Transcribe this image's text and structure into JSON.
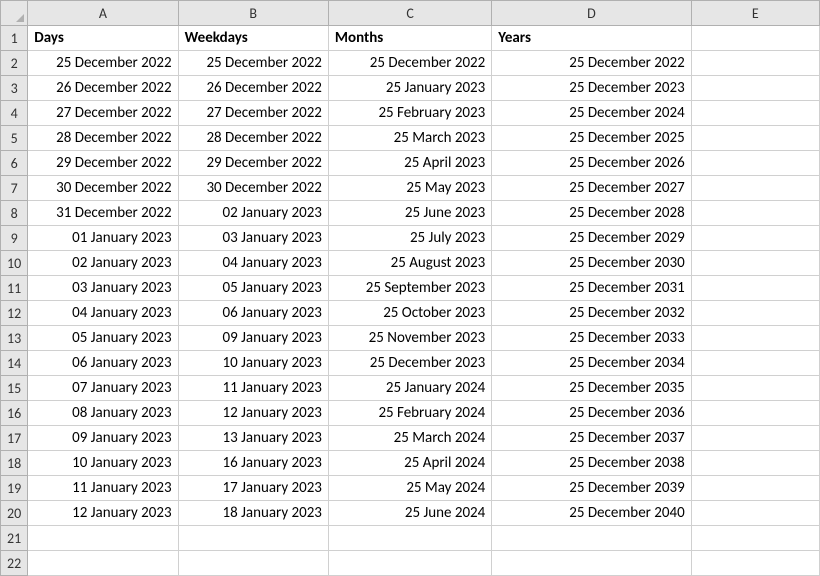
{
  "columns": [
    "A",
    "B",
    "C",
    "D",
    "E"
  ],
  "rowNumbers": [
    1,
    2,
    3,
    4,
    5,
    6,
    7,
    8,
    9,
    10,
    11,
    12,
    13,
    14,
    15,
    16,
    17,
    18,
    19,
    20,
    21,
    22
  ],
  "headers": {
    "A": "Days",
    "B": "Weekdays",
    "C": "Months",
    "D": "Years"
  },
  "data": {
    "A": [
      "25 December 2022",
      "26 December 2022",
      "27 December 2022",
      "28 December 2022",
      "29 December 2022",
      "30 December 2022",
      "31 December 2022",
      "01 January 2023",
      "02 January 2023",
      "03 January 2023",
      "04 January 2023",
      "05 January 2023",
      "06 January 2023",
      "07 January 2023",
      "08 January 2023",
      "09 January 2023",
      "10 January 2023",
      "11 January 2023",
      "12 January 2023"
    ],
    "B": [
      "25 December 2022",
      "26 December 2022",
      "27 December 2022",
      "28 December 2022",
      "29 December 2022",
      "30 December 2022",
      "02 January 2023",
      "03 January 2023",
      "04 January 2023",
      "05 January 2023",
      "06 January 2023",
      "09 January 2023",
      "10 January 2023",
      "11 January 2023",
      "12 January 2023",
      "13 January 2023",
      "16 January 2023",
      "17 January 2023",
      "18 January 2023"
    ],
    "C": [
      "25 December 2022",
      "25 January 2023",
      "25 February 2023",
      "25 March 2023",
      "25 April 2023",
      "25 May 2023",
      "25 June 2023",
      "25 July 2023",
      "25 August 2023",
      "25 September 2023",
      "25 October 2023",
      "25 November 2023",
      "25 December 2023",
      "25 January 2024",
      "25 February 2024",
      "25 March 2024",
      "25 April 2024",
      "25 May 2024",
      "25 June 2024"
    ],
    "D": [
      "25 December 2022",
      "25 December 2023",
      "25 December 2024",
      "25 December 2025",
      "25 December 2026",
      "25 December 2027",
      "25 December 2028",
      "25 December 2029",
      "25 December 2030",
      "25 December 2031",
      "25 December 2032",
      "25 December 2033",
      "25 December 2034",
      "25 December 2035",
      "25 December 2036",
      "25 December 2037",
      "25 December 2038",
      "25 December 2039",
      "25 December 2040"
    ]
  }
}
